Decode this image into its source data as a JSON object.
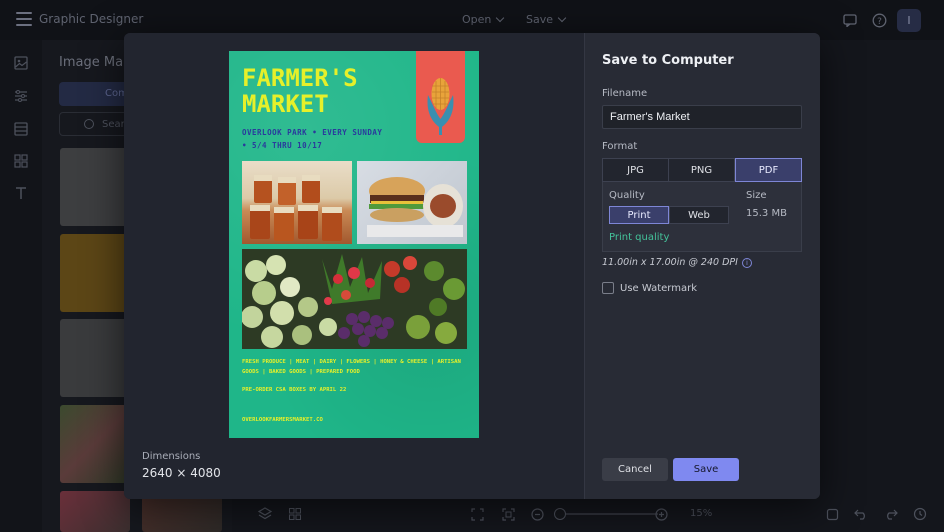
{
  "app": {
    "title": "Graphic Designer",
    "menu_open": "Open",
    "menu_save": "Save",
    "avatar_initial": "I"
  },
  "panel": {
    "title": "Image Manager",
    "tab_label": "Com",
    "search_placeholder": "Sear"
  },
  "zoom": {
    "value": "15%"
  },
  "modal": {
    "preview": {
      "poster_title": "FARMER'S MARKET",
      "poster_subtitle": "OVERLOOK PARK • EVERY SUNDAY • 5/4 THRU 10/17",
      "poster_produce": "FRESH PRODUCE | MEAT | DAIRY | FLOWERS | HONEY & CHEESE | ARTISAN GOODS | BAKED GOODS | PREPARED FOOD",
      "poster_preorder": "PRE-ORDER CSA BOXES BY APRIL 22",
      "poster_url": "OVERLOOKFARMERSMARKET.CO"
    },
    "dimensions_label": "Dimensions",
    "dimensions_value": "2640 × 4080",
    "title": "Save to Computer",
    "filename_label": "Filename",
    "filename_value": "Farmer's Market",
    "format_label": "Format",
    "formats": [
      "JPG",
      "PNG",
      "PDF"
    ],
    "selected_format": "PDF",
    "quality_label": "Quality",
    "quality_options": [
      "Print",
      "Web"
    ],
    "selected_quality": "Print",
    "size_label": "Size",
    "size_value": "15.3 MB",
    "quality_note": "Print quality",
    "dpi_text": "11.00in x 17.00in @ 240 DPI",
    "watermark_label": "Use Watermark",
    "watermark_checked": false,
    "cancel_label": "Cancel",
    "save_label": "Save"
  },
  "colors": {
    "accent": "#7f89f0",
    "selected_bg": "#3a3f6b",
    "quality_note": "#44c29a",
    "poster_bg": "#1fb689",
    "poster_title": "#e6f02a",
    "poster_subtitle": "#2a3a9c",
    "corn_badge": "#ea5a4f"
  }
}
